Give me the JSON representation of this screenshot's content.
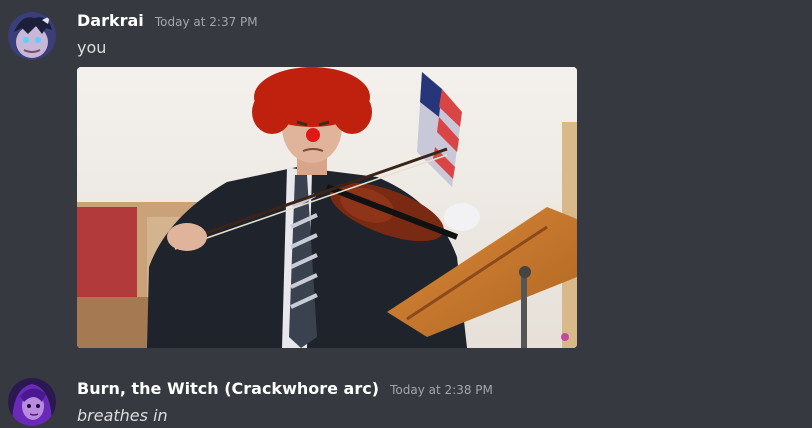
{
  "messages": [
    {
      "username": "Darkrai",
      "timestamp": "Today at 2:37 PM",
      "text": "you",
      "avatar_icon": "anime-character-avatar",
      "attachment": {
        "type": "image",
        "description_icon": "clown-violinist-image"
      }
    },
    {
      "username": "Burn, the Witch (Crackwhore arc)",
      "timestamp": "Today at 2:38 PM",
      "text": "breathes in",
      "avatar_icon": "purple-anime-character-avatar"
    }
  ],
  "colors": {
    "background": "#36393f",
    "username": "#ffffff",
    "timestamp": "#a3a6aa",
    "message_text": "#dcddde"
  }
}
